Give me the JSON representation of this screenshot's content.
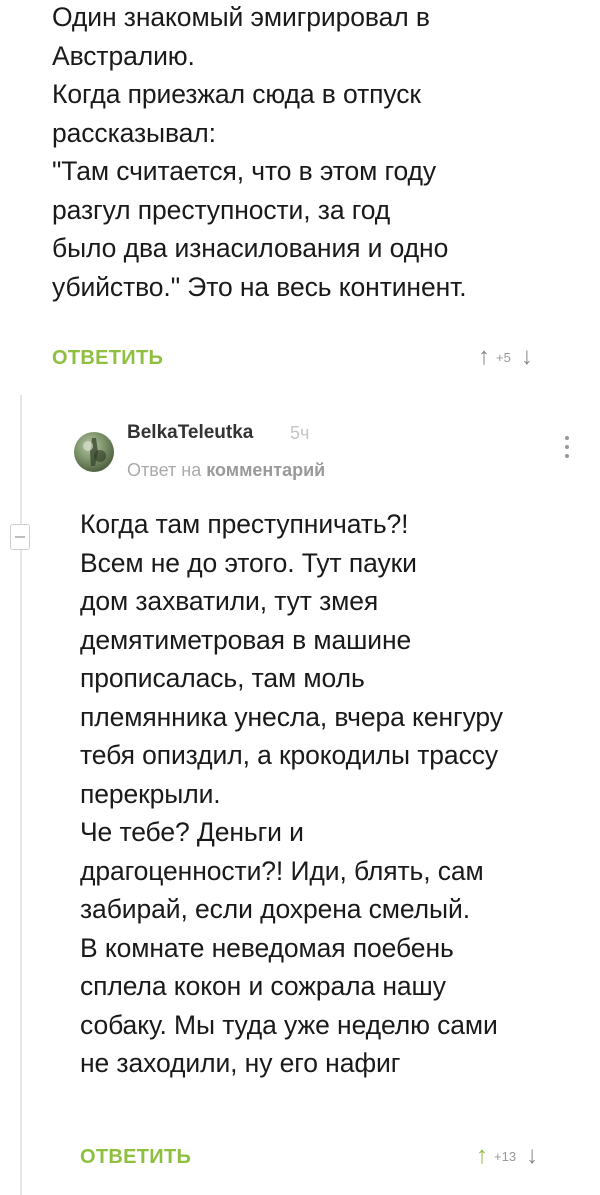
{
  "comment1": {
    "text": "Один знакомый эмигрировал в\nАвстралию.\nКогда приезжал сюда в отпуск\nрассказывал:\n\"Там считается, что в этом году\nразгул преступности, за год\nбыло два изнасилования и одно\nубийство.\" Это на весь континент.",
    "reply_label": "ОТВЕТИТЬ",
    "rating": "+5"
  },
  "comment2": {
    "author": "BelkaTeleutka",
    "time": "5ч",
    "reply_to_prefix": "Ответ на",
    "reply_to_link": "комментарий",
    "text": "Когда там преступничать?!\nВсем не до этого. Тут пауки\nдом захватили, тут змея\nдемятиметровая в машине\nпрописалась, там моль\nплемянника унесла, вчера кенгуру\nтебя опиздил, а крокодилы трассу\nперекрыли.\nЧе тебе? Деньги и\nдрагоценности?! Иди, блять, сам\nзабирай, если дохрена смелый.\nВ комнате неведомая поебень\nсплела кокон и сожрала нашу\nсобаку. Мы туда уже неделю сами\nне заходили, ну его нафиг",
    "reply_label": "ОТВЕТИТЬ",
    "rating": "+13"
  },
  "icons": {
    "upvote": "↑",
    "downvote": "↓",
    "more": "more-vertical-icon",
    "collapse": "collapse-thread-icon"
  },
  "colors": {
    "accent_green": "#8fbf3f",
    "muted_gray": "#999999"
  }
}
